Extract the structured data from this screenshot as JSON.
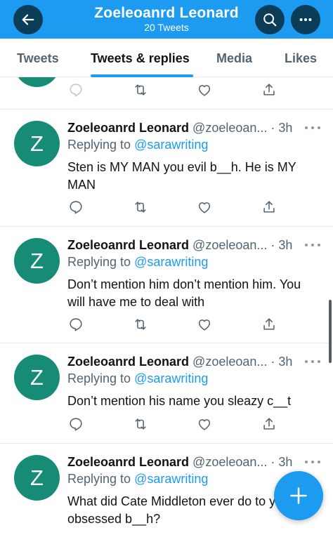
{
  "header": {
    "title": "Zoeleoanrd Leonard",
    "subtitle": "20 Tweets",
    "back_icon": "arrow-left-icon",
    "search_icon": "search-icon",
    "more_icon": "more-horizontal-icon"
  },
  "tabs": [
    {
      "label": "Tweets",
      "active": false
    },
    {
      "label": "Tweets & replies",
      "active": true
    },
    {
      "label": "Media",
      "active": false
    },
    {
      "label": "Likes",
      "active": false
    }
  ],
  "tweets": [
    {
      "avatar_letter": "Z",
      "name": "Zoeleoanrd Leonard",
      "handle": "@zoeleoan...",
      "time": "· 3h",
      "replying_prefix": "Replying to ",
      "replying_to": "@sarawriting",
      "text": "Sten is MY MAN you evil b__h. He is MY MAN"
    },
    {
      "avatar_letter": "Z",
      "name": "Zoeleoanrd Leonard",
      "handle": "@zoeleoan...",
      "time": "· 3h",
      "replying_prefix": "Replying to ",
      "replying_to": "@sarawriting",
      "text": "Don’t mention him don’t mention him. You will have me to deal with"
    },
    {
      "avatar_letter": "Z",
      "name": "Zoeleoanrd Leonard",
      "handle": "@zoeleoan...",
      "time": "· 3h",
      "replying_prefix": "Replying to ",
      "replying_to": "@sarawriting",
      "text": "Don’t mention his name you sleazy c__t"
    },
    {
      "avatar_letter": "Z",
      "name": "Zoeleoanrd Leonard",
      "handle": "@zoeleoan...",
      "time": "· 3h",
      "replying_prefix": "Replying to ",
      "replying_to": "@sarawriting",
      "text": "What did Cate Middleton ever do to you obsessed b__h?"
    }
  ],
  "action_icons": [
    "reply-icon",
    "retweet-icon",
    "like-icon",
    "share-icon"
  ],
  "compose": {
    "icon": "compose-plus-icon"
  },
  "colors": {
    "brand": "#1d9bf0",
    "header_button": "#0b3d59",
    "avatar": "#168c77",
    "secondary_text": "#536471"
  }
}
